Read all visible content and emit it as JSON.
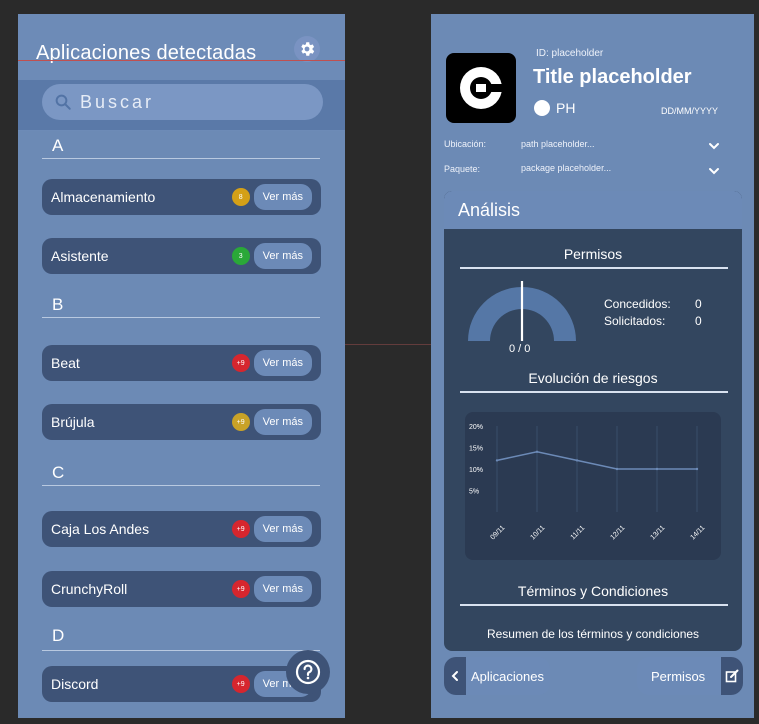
{
  "left": {
    "title": "Aplicaciones detectadas",
    "settings_icon": "gear-icon",
    "search": {
      "placeholder": "Buscar",
      "icon": "search-icon"
    },
    "sections": [
      {
        "letter": "A",
        "apps": [
          {
            "name": "Almacenamiento",
            "badge": "8",
            "badge_color": "#d4a017",
            "action": "Ver más"
          },
          {
            "name": "Asistente",
            "badge": "3",
            "badge_color": "#2aa838",
            "action": "Ver más"
          }
        ]
      },
      {
        "letter": "B",
        "apps": [
          {
            "name": "Beat",
            "badge": "+9",
            "badge_color": "#d6262e",
            "action": "Ver más"
          },
          {
            "name": "Brújula",
            "badge": "+9",
            "badge_color": "#c9a227",
            "action": "Ver más"
          }
        ]
      },
      {
        "letter": "C",
        "apps": [
          {
            "name": "Caja Los Andes",
            "badge": "+9",
            "badge_color": "#d6262e",
            "action": "Ver más"
          },
          {
            "name": "CrunchyRoll",
            "badge": "+9",
            "badge_color": "#d6262e",
            "action": "Ver más"
          }
        ]
      },
      {
        "letter": "D",
        "apps": [
          {
            "name": "Discord",
            "badge": "+9",
            "badge_color": "#d6262e",
            "action": "Ver más"
          }
        ]
      }
    ],
    "help_icon": "question-circle-icon"
  },
  "right": {
    "logo_icon": "uber-logo-icon",
    "id_text": "ID: placeholder",
    "title": "Title placeholder",
    "ph_text": "PH",
    "date_text": "DD/MM/YYYY",
    "location": {
      "label": "Ubicación:",
      "value": "path placeholder..."
    },
    "package": {
      "label": "Paquete:",
      "value": "package placeholder..."
    },
    "analysis": {
      "title": "Análisis",
      "permissions": {
        "title": "Permisos",
        "granted_label": "Concedidos:",
        "granted_value": "0",
        "requested_label": "Solicitados:",
        "requested_value": "0",
        "gauge_text": "0 / 0",
        "gauge_fraction": 0
      },
      "risk": {
        "title": "Evolución de riesgos"
      },
      "terms": {
        "title": "Términos y Condiciones",
        "summary": "Resumen de los términos y condiciones"
      }
    },
    "nav": {
      "back_label": "Aplicaciones",
      "permissions_label": "Permisos"
    }
  },
  "chart_data": {
    "type": "line",
    "x": [
      "09/11",
      "10/11",
      "11/11",
      "12/11",
      "13/11",
      "14/11"
    ],
    "series": [
      {
        "values": [
          12,
          14,
          12,
          10,
          10,
          10
        ]
      }
    ],
    "yticks": [
      "20%",
      "15%",
      "10%",
      "5%"
    ],
    "ylim": [
      0,
      20
    ],
    "grid": true,
    "line_color": "#6c8ab7"
  }
}
